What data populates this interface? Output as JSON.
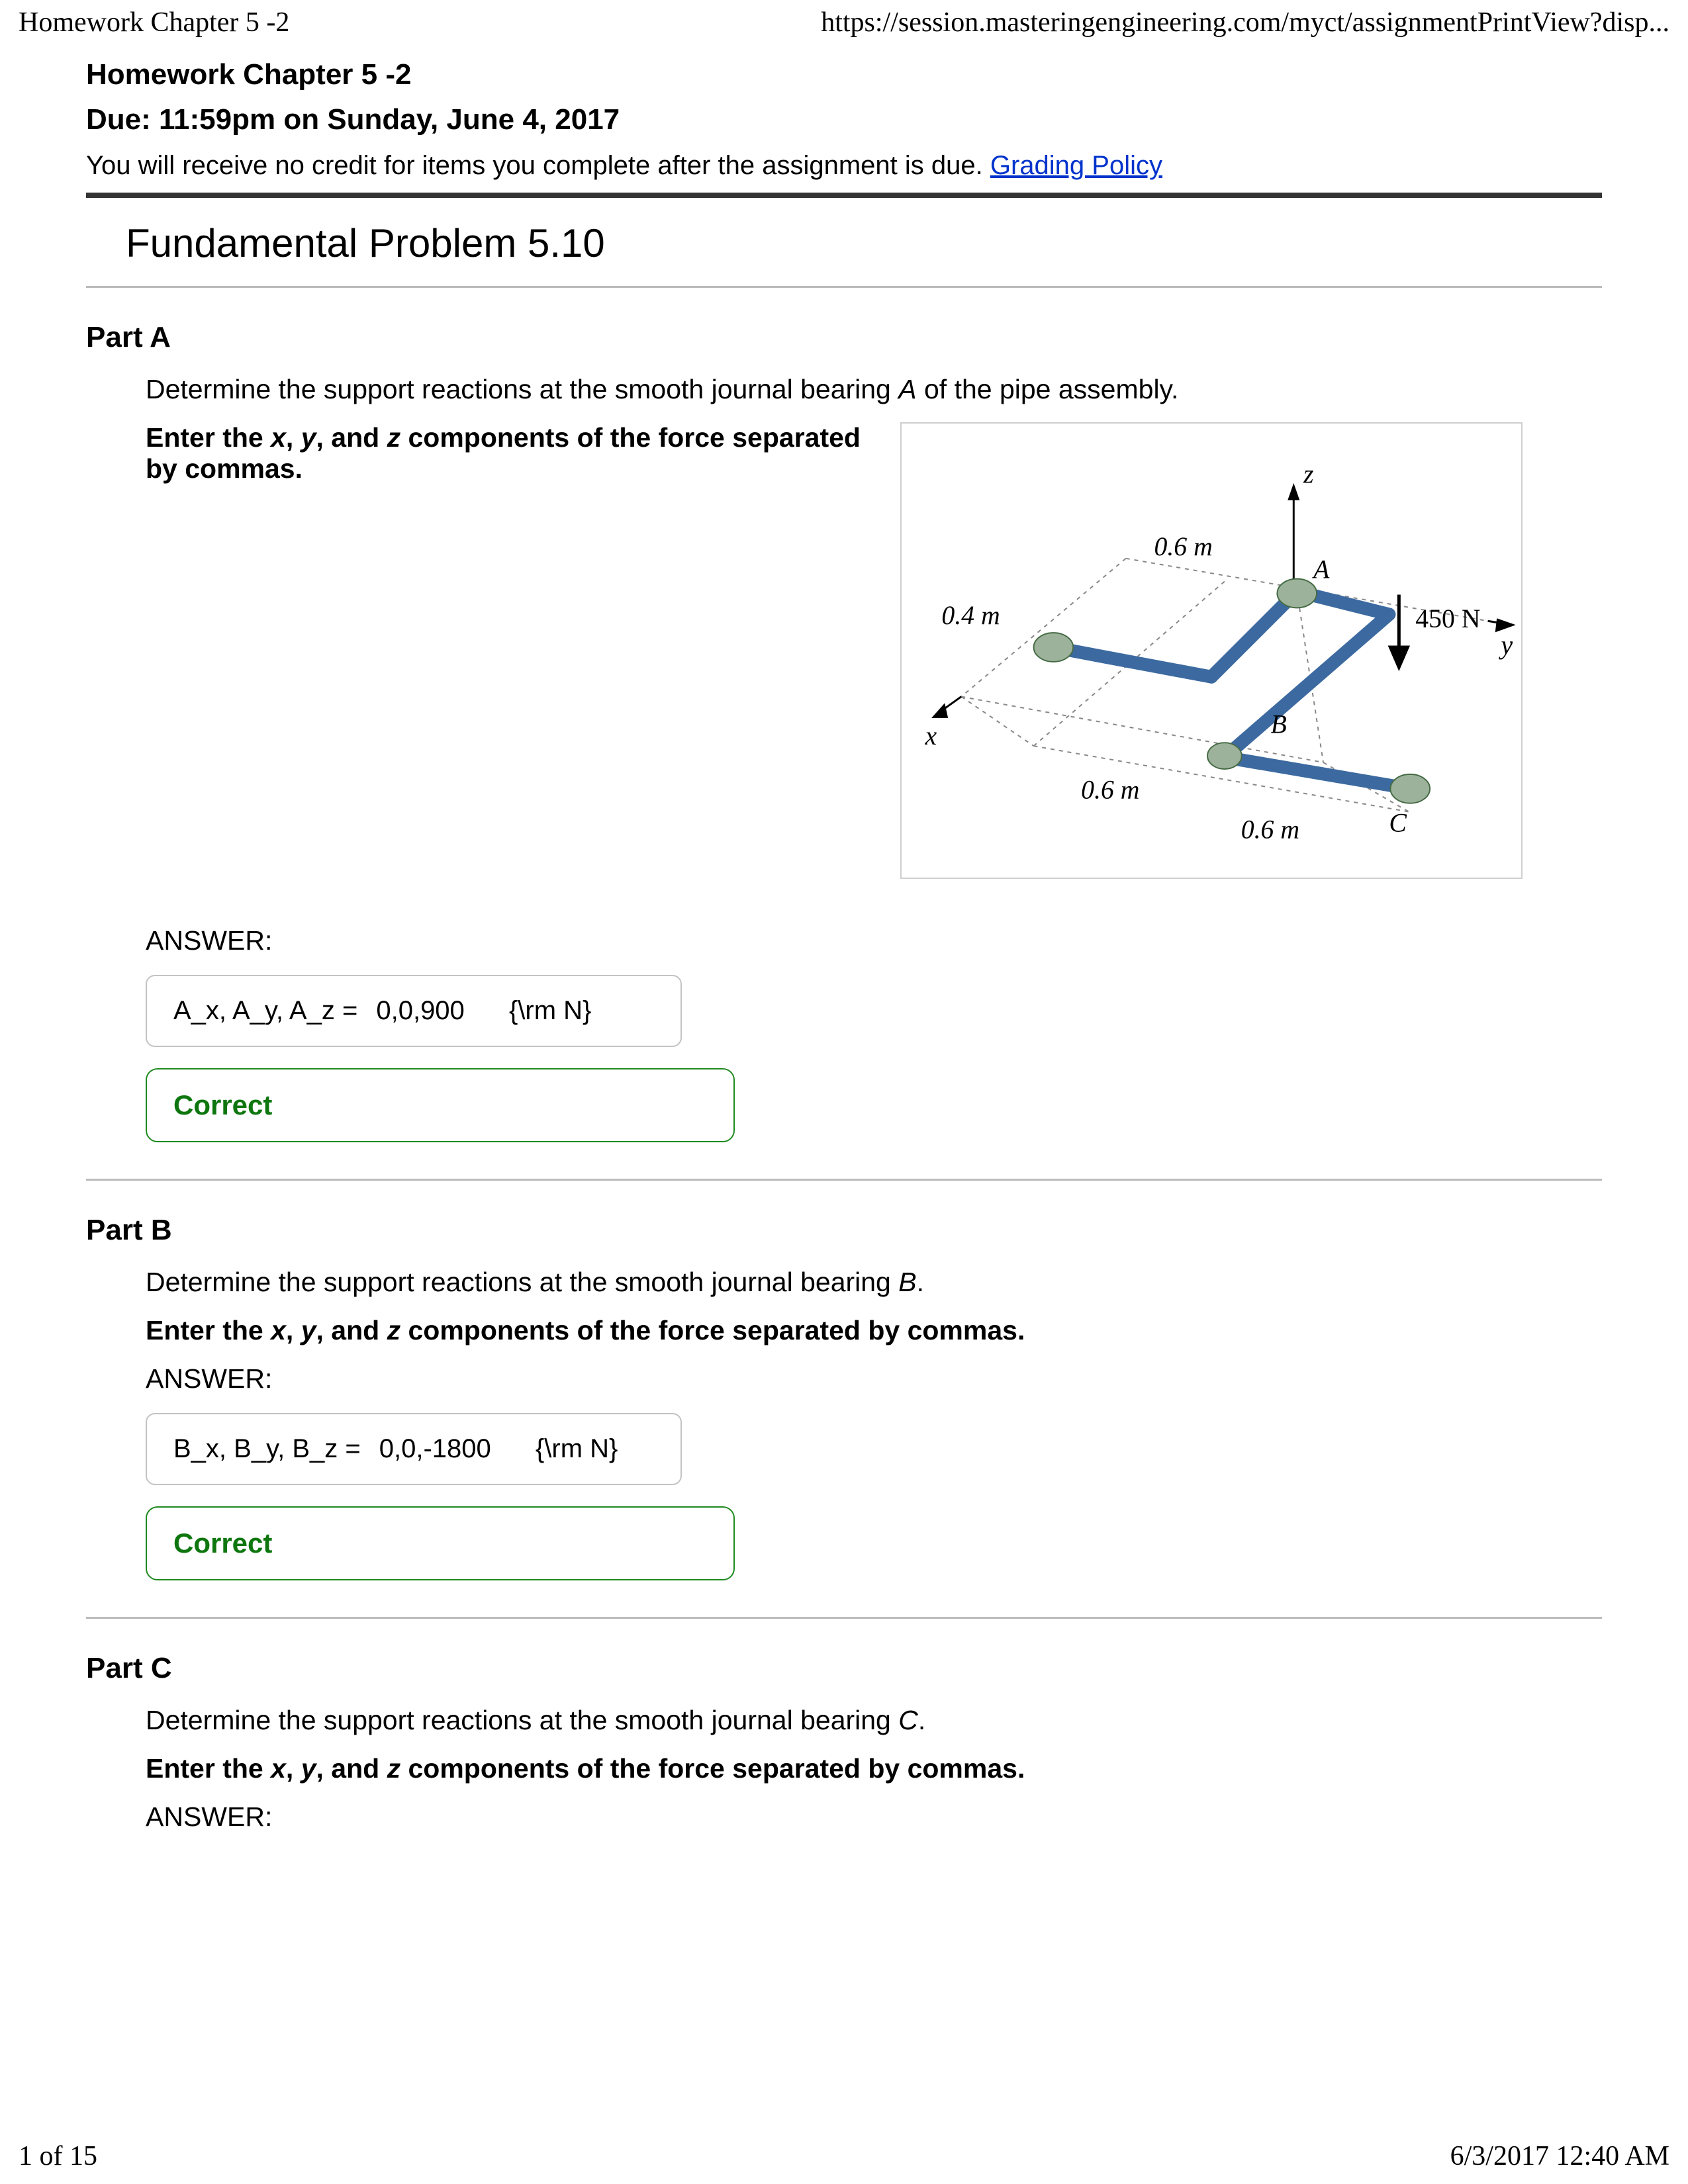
{
  "header": {
    "left": "Homework Chapter 5 -2",
    "right": "https://session.masteringengineering.com/myct/assignmentPrintView?disp..."
  },
  "assignment": {
    "title": "Homework Chapter 5 -2",
    "due": "Due: 11:59pm on Sunday, June 4, 2017",
    "credit_note_pre": "You will receive no credit for items you complete after the assignment is due. ",
    "grading_link": "Grading Policy"
  },
  "problem_title": "Fundamental Problem 5.10",
  "figure": {
    "dim_top": "0.6 m",
    "dim_left": "0.4 m",
    "dim_bottom_left": "0.6 m",
    "dim_bottom_right": "0.6 m",
    "force": "450 N",
    "axis_x": "x",
    "axis_y": "y",
    "axis_z": "z",
    "label_A": "A",
    "label_B": "B",
    "label_C": "C"
  },
  "parts": {
    "A": {
      "heading": "Part A",
      "prompt_pre": "Determine the support reactions at the smooth journal bearing ",
      "prompt_var": "A",
      "prompt_post": " of the pipe assembly.",
      "instruction_pre": "Enter the ",
      "instruction_vars": "x, y, and z",
      "instruction_post": " components of the force separated by commas.",
      "answer_vars": "A_x, A_y, A_z",
      "answer_vals": "0,0,900",
      "answer_unit": "{\\rm N}",
      "feedback": "Correct"
    },
    "B": {
      "heading": "Part B",
      "prompt_pre": "Determine the support reactions at the smooth journal bearing ",
      "prompt_var": "B",
      "prompt_post": ".",
      "instruction_pre": "Enter the ",
      "instruction_vars": "x, y, and z",
      "instruction_post": " components of the force separated by commas.",
      "answer_vars": "B_x, B_y, B_z",
      "answer_vals": "0,0,-1800",
      "answer_unit": "{\\rm N}",
      "feedback": "Correct"
    },
    "C": {
      "heading": "Part C",
      "prompt_pre": "Determine the support reactions at the smooth journal bearing ",
      "prompt_var": "C",
      "prompt_post": ".",
      "instruction_pre": "Enter the ",
      "instruction_vars": "x, y, and z",
      "instruction_post": " components of the force separated by commas."
    }
  },
  "labels": {
    "answer": "ANSWER:"
  },
  "footer": {
    "left": "1 of 15",
    "right": "6/3/2017 12:40 AM"
  }
}
